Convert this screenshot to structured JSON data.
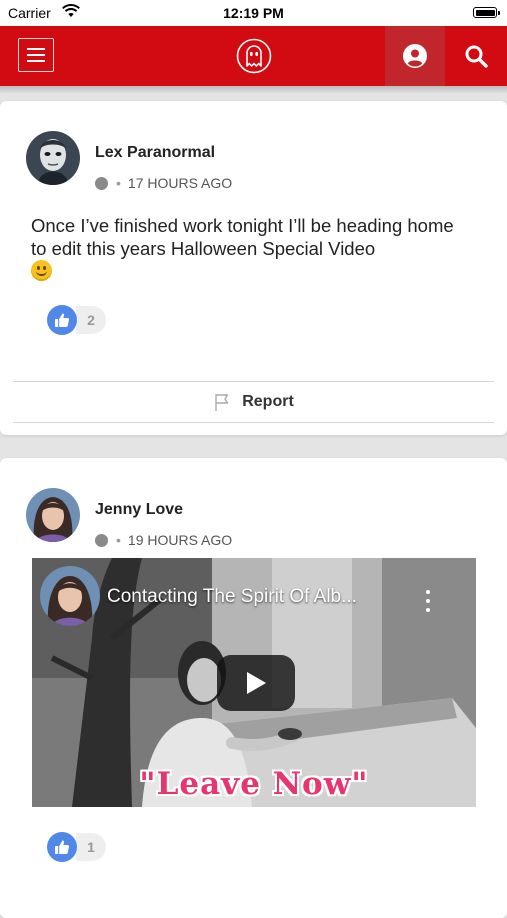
{
  "status_bar": {
    "carrier": "Carrier",
    "time": "12:19 PM"
  },
  "nav": {
    "icons": [
      "menu-icon",
      "ghost-logo-icon",
      "user-profile-icon",
      "search-icon"
    ],
    "colors": {
      "nav_bg": "#d20a11",
      "active_tab_bg": "#c0262b"
    }
  },
  "posts": [
    {
      "author": "Lex Paranormal",
      "privacy_icon": "globe-icon",
      "time_ago": "17 HOURS AGO",
      "text": "Once I’ve finished work tonight I’ll be heading home to edit this years Halloween Special Video",
      "emoji": "slightly-smiling-face",
      "likes": "2",
      "report_label": "Report"
    },
    {
      "author": "Jenny Love",
      "privacy_icon": "globe-icon",
      "time_ago": "19 HOURS AGO",
      "video": {
        "title": "Contacting The Spirit Of Alb...",
        "caption": "\"Leave Now\""
      },
      "likes": "1"
    }
  ],
  "colors": {
    "like_blue": "#4f88e8",
    "caption_pink": "#e9356e"
  }
}
